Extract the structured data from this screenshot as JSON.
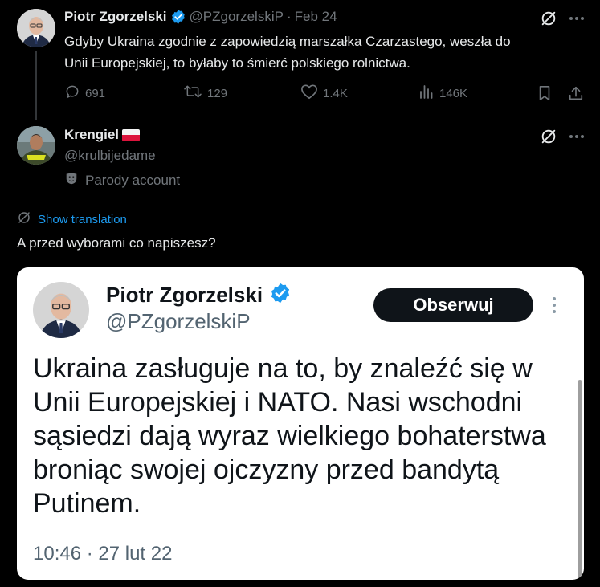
{
  "tweet1": {
    "author_name": "Piotr Zgorzelski",
    "handle": "@PZgorzelskiP",
    "separator": "·",
    "date": "Feb 24",
    "text_line1": "Gdyby Ukraina zgodnie z zapowiedzią marszałka Czarzastego, weszła do",
    "text_line2": "Unii Europejskiej, to byłaby to śmierć polskiego rolnictwa.",
    "replies": "691",
    "retweets": "129",
    "likes": "1.4K",
    "views": "146K"
  },
  "tweet2": {
    "author_name": "Krengiel",
    "handle": "@krulbijedame",
    "parody_label": "Parody account",
    "show_translation": "Show translation",
    "text": "A przed wyborami co napiszesz?"
  },
  "embed": {
    "author_name": "Piotr Zgorzelski",
    "handle": "@PZgorzelskiP",
    "follow_label": "Obserwuj",
    "text_lines": [
      "Ukraina zasługuje na to, by znaleźć się w",
      "Unii Europejskiej i NATO. Nasi wschodni",
      "sąsiedzi dają wyraz wielkiego bohaterstwa",
      "broniąc swojej ojczyzny przed bandytą",
      "Putinem."
    ],
    "timestamp": "10:46 · 27 lut 22"
  },
  "colors": {
    "background": "#000000",
    "text": "#e7e9ea",
    "muted": "#71767b",
    "link": "#1d9bf0",
    "verified": "#1d9bf0",
    "thread_line": "#333639"
  },
  "icons": [
    "grok-icon",
    "more-icon",
    "reply-icon",
    "retweet-icon",
    "like-icon",
    "views-icon",
    "bookmark-icon",
    "share-icon",
    "verified-badge-icon",
    "poland-flag-icon",
    "parody-mask-icon",
    "translate-icon"
  ]
}
